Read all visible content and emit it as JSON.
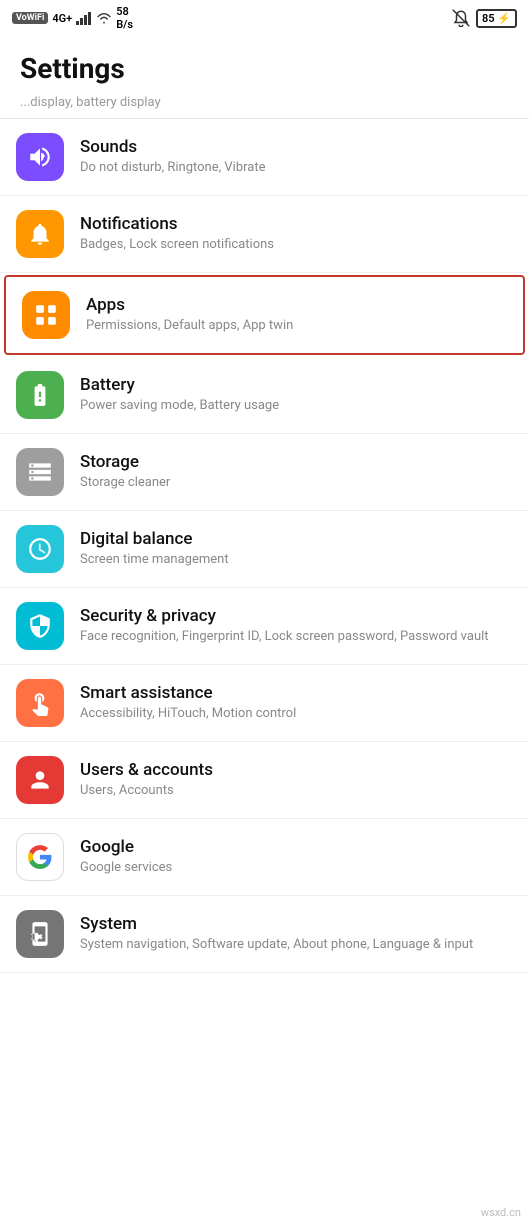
{
  "statusBar": {
    "leftItems": [
      "VoWiFi",
      "4G+",
      "signal",
      "wifi",
      "58 B/s"
    ],
    "bell": "🔕",
    "battery": "85",
    "charging": "⚡"
  },
  "page": {
    "title": "Settings",
    "scrollHint": "...display, battery display"
  },
  "items": [
    {
      "id": "sounds",
      "title": "Sounds",
      "subtitle": "Do not disturb, Ringtone, Vibrate",
      "iconBg": "bg-purple",
      "iconName": "sound-icon"
    },
    {
      "id": "notifications",
      "title": "Notifications",
      "subtitle": "Badges, Lock screen notifications",
      "iconBg": "bg-orange",
      "iconName": "notification-icon"
    },
    {
      "id": "apps",
      "title": "Apps",
      "subtitle": "Permissions, Default apps, App twin",
      "iconBg": "bg-orange2",
      "iconName": "apps-icon",
      "highlighted": true
    },
    {
      "id": "battery",
      "title": "Battery",
      "subtitle": "Power saving mode, Battery usage",
      "iconBg": "bg-green",
      "iconName": "battery-icon"
    },
    {
      "id": "storage",
      "title": "Storage",
      "subtitle": "Storage cleaner",
      "iconBg": "bg-gray",
      "iconName": "storage-icon"
    },
    {
      "id": "digital-balance",
      "title": "Digital balance",
      "subtitle": "Screen time management",
      "iconBg": "bg-teal",
      "iconName": "digital-balance-icon"
    },
    {
      "id": "security",
      "title": "Security & privacy",
      "subtitle": "Face recognition, Fingerprint ID, Lock screen password, Password vault",
      "iconBg": "bg-teal2",
      "iconName": "security-icon"
    },
    {
      "id": "smart-assistance",
      "title": "Smart assistance",
      "subtitle": "Accessibility, HiTouch, Motion control",
      "iconBg": "bg-orange3",
      "iconName": "smart-assistance-icon"
    },
    {
      "id": "users-accounts",
      "title": "Users & accounts",
      "subtitle": "Users, Accounts",
      "iconBg": "bg-red",
      "iconName": "users-icon"
    },
    {
      "id": "google",
      "title": "Google",
      "subtitle": "Google services",
      "iconBg": "bg-white-border",
      "iconName": "google-icon"
    },
    {
      "id": "system",
      "title": "System",
      "subtitle": "System navigation, Software update, About phone, Language & input",
      "iconBg": "bg-darkgray",
      "iconName": "system-icon"
    }
  ]
}
